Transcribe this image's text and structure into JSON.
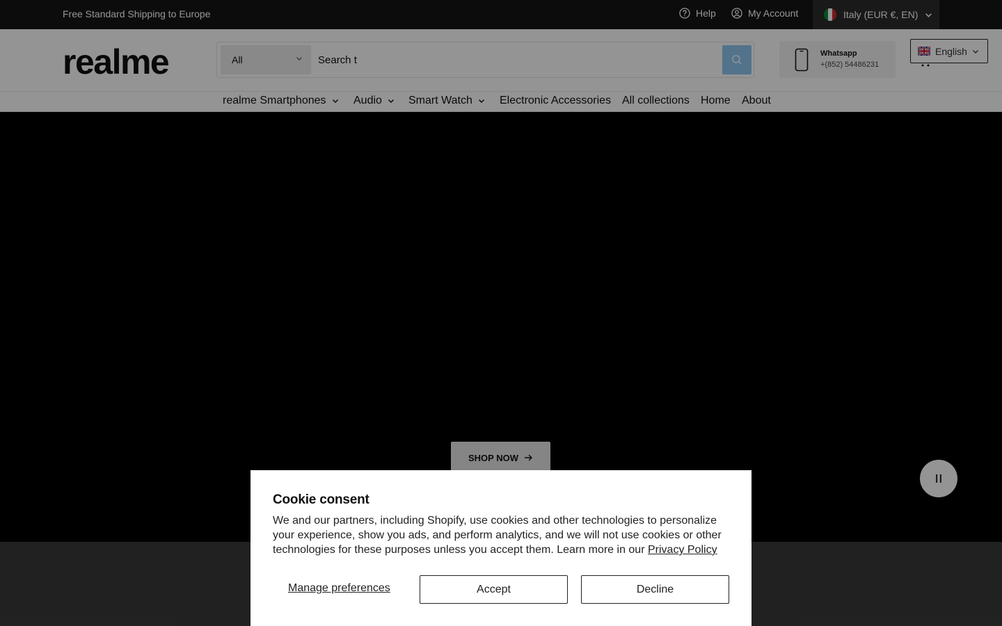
{
  "topbar": {
    "shipping": "Free Standard Shipping to Europe",
    "help": "Help",
    "account": "My Account",
    "country": "Italy (EUR €, EN)"
  },
  "header": {
    "logo": "realme",
    "search": {
      "category": "All",
      "value": "Search t"
    },
    "whatsapp": {
      "label": "Whatsapp",
      "number": "+(852) 54486231"
    },
    "language": "English"
  },
  "nav": {
    "items": [
      {
        "label": "realme Smartphones",
        "dropdown": true
      },
      {
        "label": "Audio",
        "dropdown": true
      },
      {
        "label": "Smart Watch",
        "dropdown": true
      },
      {
        "label": "Electronic Accessories",
        "dropdown": false
      },
      {
        "label": "All collections",
        "dropdown": false
      },
      {
        "label": "Home",
        "dropdown": false
      },
      {
        "label": "About",
        "dropdown": false
      }
    ]
  },
  "hero": {
    "cta": "SHOP NOW"
  },
  "cookie": {
    "title": "Cookie consent",
    "body": "We and our partners, including Shopify, use cookies and other technologies to personalize your experience, show you ads, and perform analytics, and we will not use cookies or other technologies for these purposes unless you accept them. Learn more in our",
    "link": "Privacy Policy",
    "manage": "Manage preferences",
    "accept": "Accept",
    "decline": "Decline"
  },
  "colors": {
    "topbar_bg": "#161616",
    "search_button": "#8ec6f0",
    "hero_bg": "#000000"
  }
}
